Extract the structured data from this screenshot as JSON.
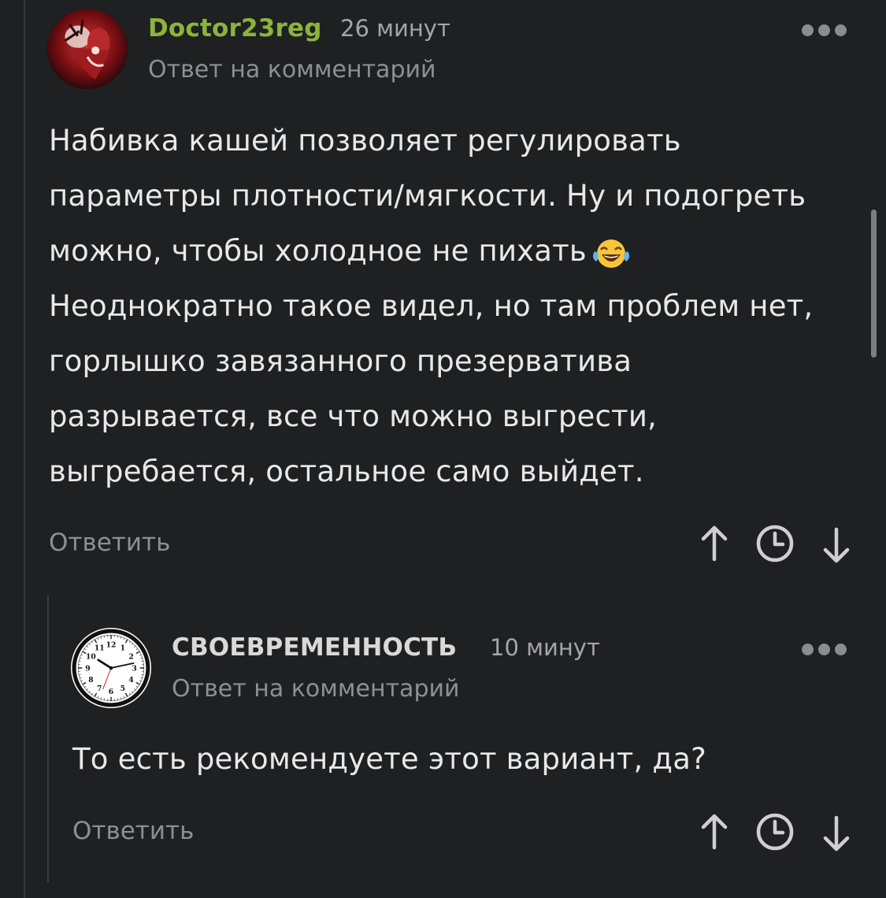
{
  "comments": [
    {
      "author": "Doctor23reg",
      "author_color": "#8bb53a",
      "time": "26 минут",
      "subline": "Ответ на комментарий",
      "body_lines": [
        "Набивка кашей позволяет регулировать",
        "параметры плотности/мягкости. Ну и подогреть",
        "можно, чтобы холодное не пихать",
        "Неоднократно такое видел, но там проблем нет,",
        "горлышко завязанного презерватива",
        "разрывается, все что можно выгрести,",
        "выгребается, остальное само выйдет."
      ],
      "emoji": "face-with-tears-of-joy",
      "reply_label": "Ответить"
    },
    {
      "author": "СВОЕВРЕМЕННОСТЬ",
      "author_color": "#d9d9d9",
      "time": "10 минут",
      "subline": "Ответ на комментарий",
      "body_lines": [
        "То есть рекомендуете этот вариант, да?"
      ],
      "reply_label": "Ответить",
      "avatar_clock": {
        "numerals": [
          "12",
          "1",
          "2",
          "3",
          "4",
          "5",
          "6",
          "7",
          "8",
          "9",
          "10",
          "11"
        ]
      }
    }
  ],
  "icons": {
    "more": "more-dots-icon",
    "upvote": "arrow-up-icon",
    "save": "clock-icon",
    "downvote": "arrow-down-icon"
  },
  "colors": {
    "background": "#1f2022",
    "muted_text": "#8e8f93",
    "body_text": "#e8e8e8",
    "accent_author": "#8bb53a"
  }
}
